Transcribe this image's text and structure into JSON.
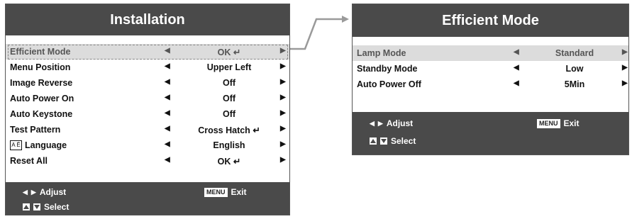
{
  "installation": {
    "title": "Installation",
    "items": [
      {
        "label": "Efficient Mode",
        "value": "OK",
        "enter": true,
        "selected": true
      },
      {
        "label": "Menu Position",
        "value": "Upper Left",
        "enter": false
      },
      {
        "label": "Image Reverse",
        "value": "Off",
        "enter": false
      },
      {
        "label": "Auto Power On",
        "value": "Off",
        "enter": false
      },
      {
        "label": "Auto Keystone",
        "value": "Off",
        "enter": false
      },
      {
        "label": "Test Pattern",
        "value": "Cross Hatch",
        "enter": true
      },
      {
        "label": "Language",
        "value": "English",
        "enter": false,
        "icon": "language-icon"
      },
      {
        "label": "Reset All",
        "value": "OK",
        "enter": true
      }
    ],
    "footer": {
      "adjust": "Adjust",
      "select": "Select",
      "menu_key": "MENU",
      "exit": "Exit"
    }
  },
  "efficient": {
    "title": "Efficient Mode",
    "items": [
      {
        "label": "Lamp Mode",
        "value": "Standard",
        "selected": true
      },
      {
        "label": "Standby Mode",
        "value": "Low"
      },
      {
        "label": "Auto Power Off",
        "value": "5Min"
      }
    ],
    "footer": {
      "adjust": "Adjust",
      "select": "Select",
      "menu_key": "MENU",
      "exit": "Exit"
    }
  },
  "language_icon_text": "A Ë",
  "colors": {
    "header": "#4a4a4a",
    "selected_row": "#dcdcdc",
    "connector": "#9a9a9a"
  }
}
